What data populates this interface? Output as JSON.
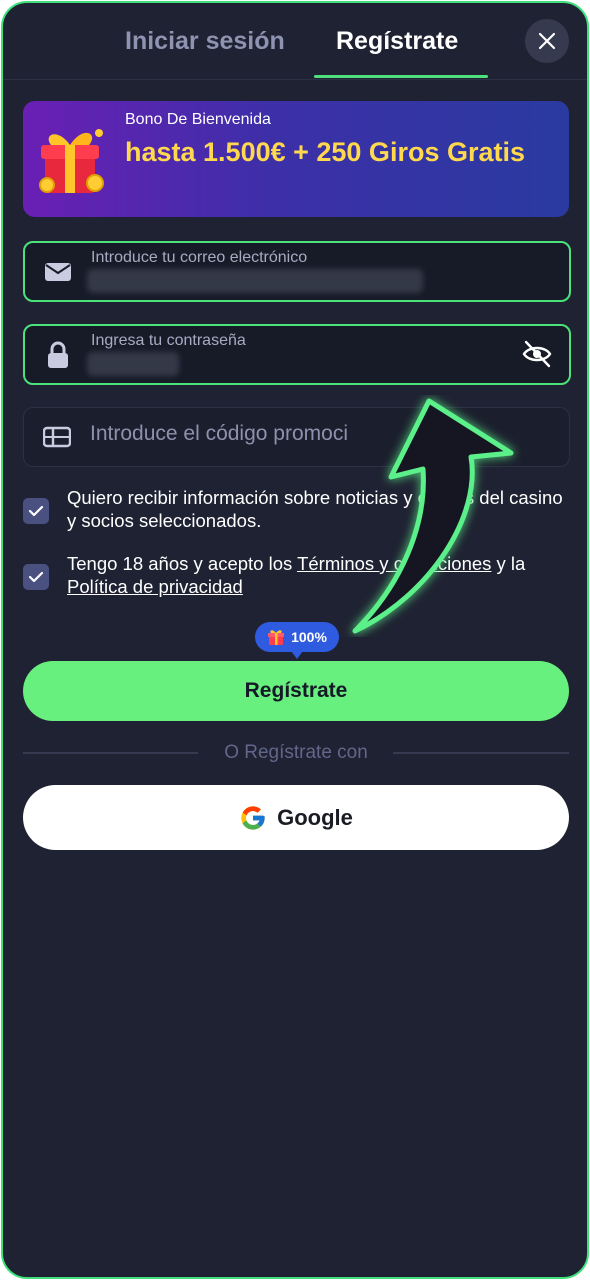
{
  "tabs": {
    "login": "Iniciar sesión",
    "register": "Regístrate"
  },
  "close_icon": "close-icon",
  "banner": {
    "subtitle": "Bono De Bienvenida",
    "title": "hasta 1.500€ + 250 Giros Gratis",
    "icon": "gift-icon"
  },
  "email": {
    "label": "Introduce tu correo electrónico",
    "icon": "mail-icon"
  },
  "password": {
    "label": "Ingresa tu contraseña",
    "icon": "lock-icon",
    "toggle_icon": "eye-off-icon"
  },
  "promo": {
    "placeholder": "Introduce el código promoci",
    "icon": "gift-card-icon"
  },
  "consents": {
    "marketing": "Quiero recibir información sobre noticias y ofertas del casino y socios seleccionados.",
    "terms_prefix": "Tengo 18 años y acepto los ",
    "terms_link": "Términos y condiciones",
    "terms_middle": " y la ",
    "privacy_link": "Política de privacidad"
  },
  "badge": {
    "label": "100%",
    "icon": "gift-icon"
  },
  "register_button": "Regístrate",
  "divider_text": "O Regístrate con",
  "google_button": "Google",
  "colors": {
    "background": "#1f2232",
    "accent": "#67f07e",
    "banner_title": "#ffd84d",
    "badge": "#2f5be0",
    "frame_border": "#3ee07a"
  }
}
